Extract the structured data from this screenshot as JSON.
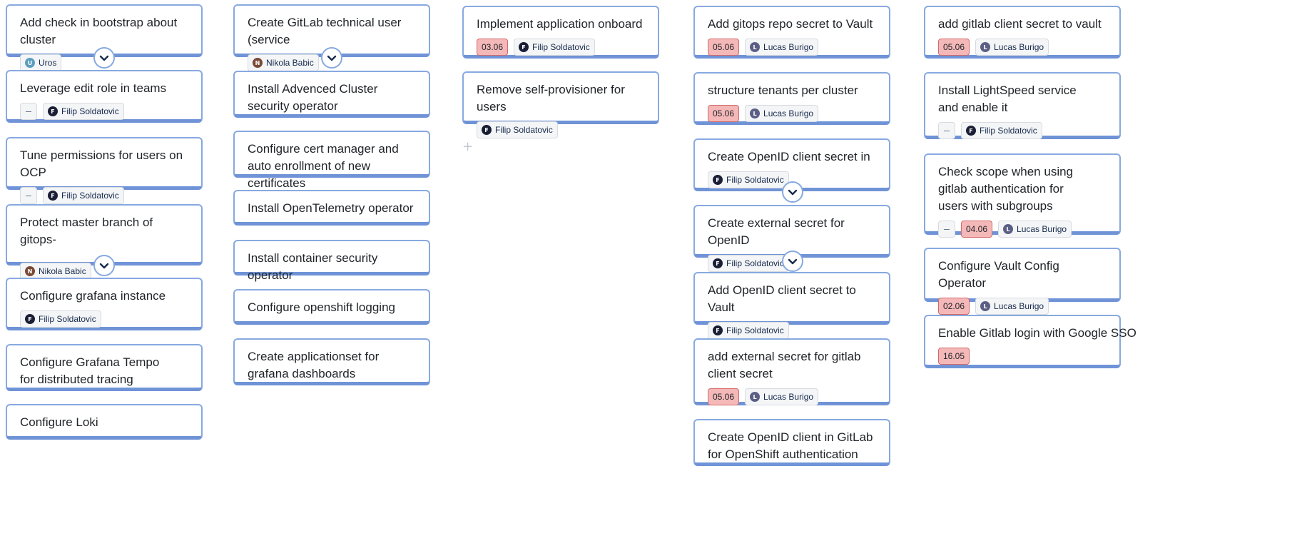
{
  "columns": [
    {
      "cards": [
        {
          "title": "Add check in bootstrap about cluster",
          "assignee": "Uros",
          "avatar_letter": "U",
          "avatar_color": "#5b9fc0"
        },
        {
          "title": "Leverage edit role in teams",
          "has_description": true,
          "assignee": "Filip Soldatovic",
          "avatar_letter": "F",
          "avatar_color": "#1a1f36"
        },
        {
          "title": "Tune permissions for users on OCP",
          "has_description": true,
          "assignee": "Filip Soldatovic",
          "avatar_letter": "F",
          "avatar_color": "#1a1f36"
        },
        {
          "title": "Protect master branch of gitops-",
          "assignee": "Nikola Babic",
          "avatar_letter": "N",
          "avatar_color": "#7a4a36"
        },
        {
          "title": "Configure grafana instance",
          "assignee": "Filip Soldatovic",
          "avatar_letter": "F",
          "avatar_color": "#1a1f36"
        },
        {
          "title": "Configure Grafana Tempo for distributed tracing"
        },
        {
          "title": "Configure Loki"
        }
      ]
    },
    {
      "cards": [
        {
          "title": "Create GitLab technical user (service",
          "assignee": "Nikola Babic",
          "avatar_letter": "N",
          "avatar_color": "#7a4a36"
        },
        {
          "title": "Install Advenced Cluster security operator"
        },
        {
          "title": "Configure cert manager and auto enrollment of new certificates"
        },
        {
          "title": "Install OpenTelemetry operator"
        },
        {
          "title": "Install container security operator"
        },
        {
          "title": "Configure openshift logging"
        },
        {
          "title": "Create applicationset for grafana dashboards"
        }
      ]
    },
    {
      "cards": [
        {
          "title": "Implement application onboard",
          "date": "03.06",
          "assignee": "Filip Soldatovic",
          "avatar_letter": "F",
          "avatar_color": "#1a1f36"
        },
        {
          "title": "Remove self-provisioner for users",
          "assignee": "Filip Soldatovic",
          "avatar_letter": "F",
          "avatar_color": "#1a1f36"
        }
      ],
      "add_symbol": "+"
    },
    {
      "cards": [
        {
          "title": "Add gitops repo secret to Vault",
          "date": "05.06",
          "assignee": "Lucas Burigo",
          "avatar_letter": "L",
          "avatar_color": "#5c5f85"
        },
        {
          "title": "structure tenants per cluster",
          "date": "05.06",
          "assignee": "Lucas Burigo",
          "avatar_letter": "L",
          "avatar_color": "#5c5f85"
        },
        {
          "title": "Create OpenID client secret in",
          "assignee": "Filip Soldatovic",
          "avatar_letter": "F",
          "avatar_color": "#1a1f36"
        },
        {
          "title": "Create external secret for OpenID",
          "assignee": "Filip Soldatovic",
          "avatar_letter": "F",
          "avatar_color": "#1a1f36"
        },
        {
          "title": "Add OpenID client secret to Vault",
          "assignee": "Filip Soldatovic",
          "avatar_letter": "F",
          "avatar_color": "#1a1f36"
        },
        {
          "title": "add external secret for gitlab client secret",
          "date": "05.06",
          "assignee": "Lucas Burigo",
          "avatar_letter": "L",
          "avatar_color": "#5c5f85"
        },
        {
          "title": "Create OpenID client in GitLab for OpenShift authentication"
        }
      ]
    },
    {
      "cards": [
        {
          "title": "add gitlab client secret to vault",
          "date": "05.06",
          "assignee": "Lucas Burigo",
          "avatar_letter": "L",
          "avatar_color": "#5c5f85"
        },
        {
          "title": "Install LightSpeed service and enable it",
          "has_description": true,
          "assignee": "Filip Soldatovic",
          "avatar_letter": "F",
          "avatar_color": "#1a1f36"
        },
        {
          "title": "Check scope when using gitlab authentication for users with subgroups",
          "has_description": true,
          "date": "04.06",
          "assignee": "Lucas Burigo",
          "avatar_letter": "L",
          "avatar_color": "#5c5f85"
        },
        {
          "title": "Configure Vault Config Operator",
          "date": "02.06",
          "assignee": "Lucas Burigo",
          "avatar_letter": "L",
          "avatar_color": "#5c5f85"
        },
        {
          "title": "Enable Gitlab login with Google SSO",
          "date": "16.05"
        }
      ]
    }
  ]
}
